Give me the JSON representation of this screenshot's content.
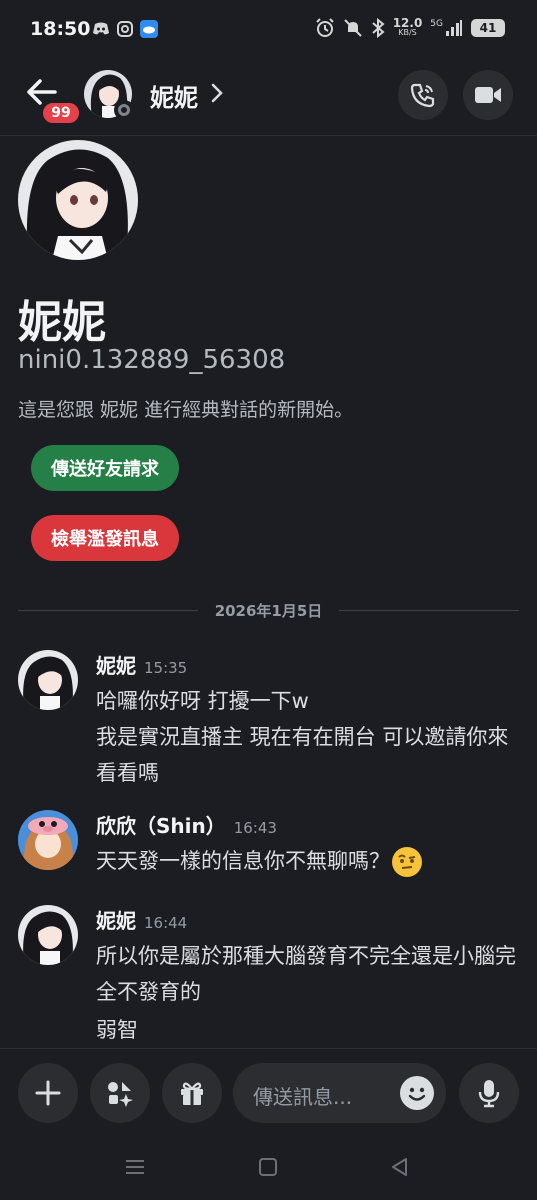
{
  "status_bar": {
    "time": "18:50",
    "net_speed": "12.0",
    "net_unit": "KB/S",
    "network": "5G",
    "battery": "41"
  },
  "header": {
    "unread_badge": "99",
    "name": "妮妮"
  },
  "profile": {
    "display_name": "妮妮",
    "username": "nini0.132889_56308",
    "intro": "這是您跟 妮妮 進行經典對話的新開始。",
    "friend_request_label": "傳送好友請求",
    "report_spam_label": "檢舉濫發訊息"
  },
  "date_divider": "2026年1月5日",
  "messages": [
    {
      "author": "妮妮",
      "time": "15:35",
      "lines": [
        "哈囉你好呀 打擾一下w",
        "我是實況直播主 現在有在開台 可以邀請你來看看嗎"
      ]
    },
    {
      "author": "欣欣（Shin）",
      "time": "16:43",
      "lines": [
        "天天發一樣的信息你不無聊嗎？"
      ],
      "emoji": "face-with-raised-eyebrow"
    },
    {
      "author": "妮妮",
      "time": "16:44",
      "lines": [
        "所以你是屬於那種大腦發育不完全還是小腦完全不發育的",
        "弱智"
      ]
    }
  ],
  "composer": {
    "placeholder": "傳送訊息..."
  },
  "colors": {
    "background": "#1c1d22",
    "green_button": "#248046",
    "red_button": "#da373c",
    "badge": "#e5414a"
  }
}
